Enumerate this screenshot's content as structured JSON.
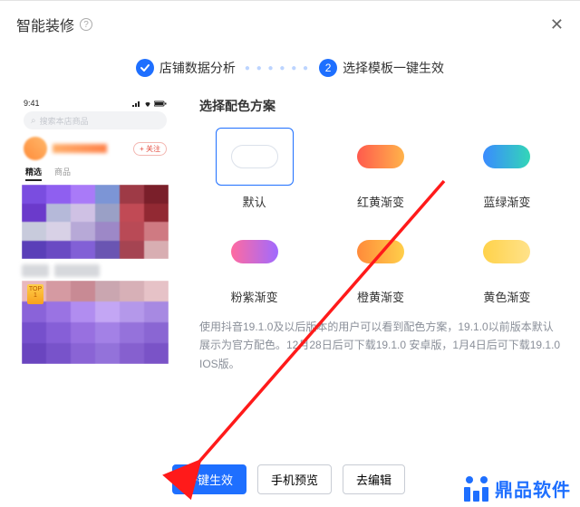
{
  "header": {
    "title": "智能装修",
    "help": "?"
  },
  "steps": {
    "step1_label": "店铺数据分析",
    "step2_num": "2",
    "step2_label": "选择模板一键生效"
  },
  "phone": {
    "time": "9:41",
    "search_placeholder": "搜索本店商品",
    "follow": "+ 关注",
    "tab1": "精选",
    "tab2": "商品",
    "top_badge": "TOP\n1"
  },
  "panel": {
    "title": "选择配色方案",
    "schemes": [
      {
        "label": "默认",
        "selected": true,
        "gradient": "linear-gradient(90deg,#e7ecf3,#f3f6fb)"
      },
      {
        "label": "红黄渐变",
        "selected": false,
        "gradient": "linear-gradient(90deg,#ff5a4d,#ffb34a)"
      },
      {
        "label": "蓝绿渐变",
        "selected": false,
        "gradient": "linear-gradient(90deg,#3a8bff,#33d6b7)"
      },
      {
        "label": "粉紫渐变",
        "selected": false,
        "gradient": "linear-gradient(90deg,#ff6aa0,#a06aff)"
      },
      {
        "label": "橙黄渐变",
        "selected": false,
        "gradient": "linear-gradient(90deg,#ff8a3a,#ffcf4a)"
      },
      {
        "label": "黄色渐变",
        "selected": false,
        "gradient": "linear-gradient(90deg,#ffd24a,#ffe28a)"
      }
    ],
    "note": "使用抖音19.1.0及以后版本的用户可以看到配色方案，19.1.0以前版本默认展示为官方配色。12月28日后可下载19.1.0 安卓版，1月4日后可下载19.1.0 IOS版。"
  },
  "footer": {
    "btn_apply": "一键生效",
    "btn_preview": "手机预览",
    "btn_edit": "去编辑"
  },
  "watermark": {
    "text": "鼎品软件"
  }
}
